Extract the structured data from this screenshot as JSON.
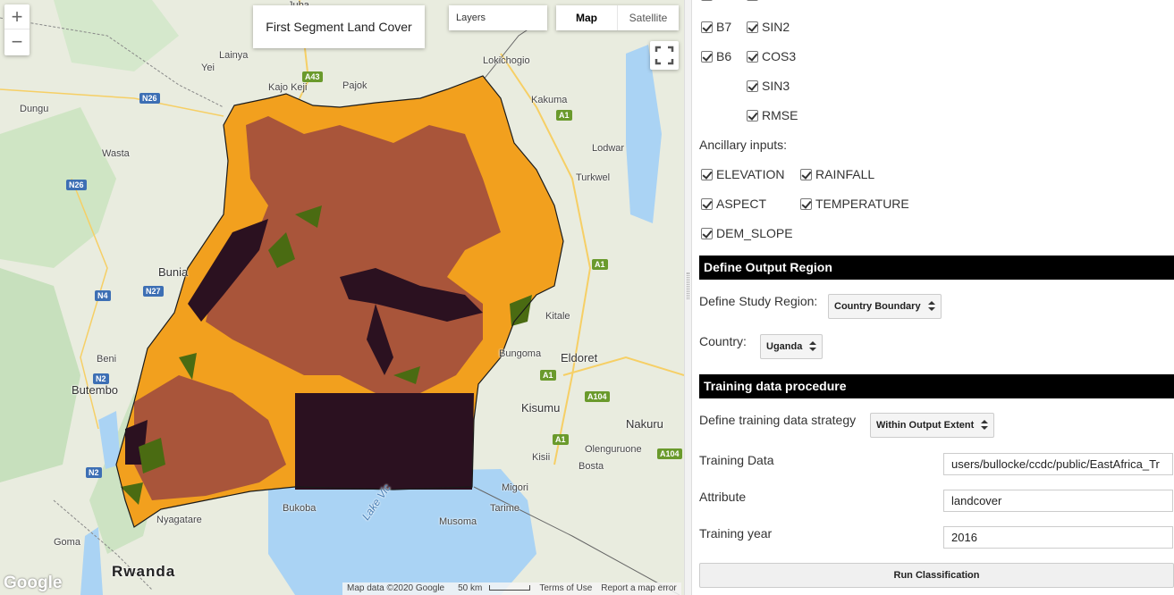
{
  "map": {
    "title": "First Segment Land Cover",
    "layers_label": "Layers",
    "map_type_map": "Map",
    "map_type_satellite": "Satellite",
    "zoom_in": "+",
    "zoom_out": "−",
    "google_logo": "Google",
    "attribution": "Map data ©2020 Google",
    "scale": "50 km",
    "terms": "Terms of Use",
    "report": "Report a map error",
    "place_labels": {
      "juba": "Juba",
      "kajo_keji": "Kajo Keji",
      "pajok": "Pajok",
      "lainya": "Lainya",
      "yei": "Yei",
      "lokichogio": "Lokichogio",
      "kakuma": "Kakuma",
      "dungu": "Dungu",
      "wasta": "Wasta",
      "lodwar": "Lodwar",
      "turkwel": "Turkwel",
      "bunia": "Bunia",
      "beni": "Beni",
      "butembo": "Butembo",
      "kitale": "Kitale",
      "bungoma": "Bungoma",
      "eldoret": "Eldoret",
      "kisumu": "Kisumu",
      "nakuru": "Nakuru",
      "kisii": "Kisii",
      "oldonyo": "Olenguruone",
      "bosta": "Bosta",
      "migori": "Migori",
      "tarime": "Tarime",
      "musoma": "Musoma",
      "bukoba": "Bukoba",
      "nyagatare": "Nyagatare",
      "goma": "Goma",
      "rwanda": "Rwanda",
      "lake_victoria": "Lake Vic"
    },
    "road_shields": {
      "a43": "A43",
      "a1_north": "A1",
      "n26_a": "N26",
      "n26_b": "N26",
      "n4": "N4",
      "n27": "N27",
      "n2_a": "N2",
      "n2_b": "N2",
      "a1_a": "A1",
      "a1_b": "A1",
      "a1_c": "A1",
      "a104_a": "A104",
      "a104_b": "A104"
    },
    "colors": {
      "class_orange": "#f2a01e",
      "class_brown": "#a9553a",
      "class_dark": "#2b1120",
      "class_green": "#4a6b12",
      "water": "#aad3f4",
      "land": "#e9ecdf"
    }
  },
  "panel": {
    "top_checkboxes": {
      "b7": "B7",
      "b6": "B6",
      "sin2": "SIN2",
      "cos3": "COS3",
      "sin3": "SIN3",
      "rmse": "RMSE"
    },
    "ancillary_label": "Ancillary inputs:",
    "ancillary": {
      "elevation": "ELEVATION",
      "rainfall": "RAINFALL",
      "aspect": "ASPECT",
      "temperature": "TEMPERATURE",
      "dem_slope": "DEM_SLOPE"
    },
    "output_region": {
      "header": "Define Output Region",
      "study_region_label": "Define Study Region:",
      "study_region_value": "Country Boundary",
      "country_label": "Country:",
      "country_value": "Uganda"
    },
    "training": {
      "header": "Training data procedure",
      "strategy_label": "Define training data strategy",
      "strategy_value": "Within Output Extent",
      "data_label": "Training Data",
      "data_value": "users/bullocke/ccdc/public/EastAfrica_Tr",
      "attribute_label": "Attribute",
      "attribute_value": "landcover",
      "year_label": "Training year",
      "year_value": "2016"
    },
    "run_button": "Run Classification"
  }
}
